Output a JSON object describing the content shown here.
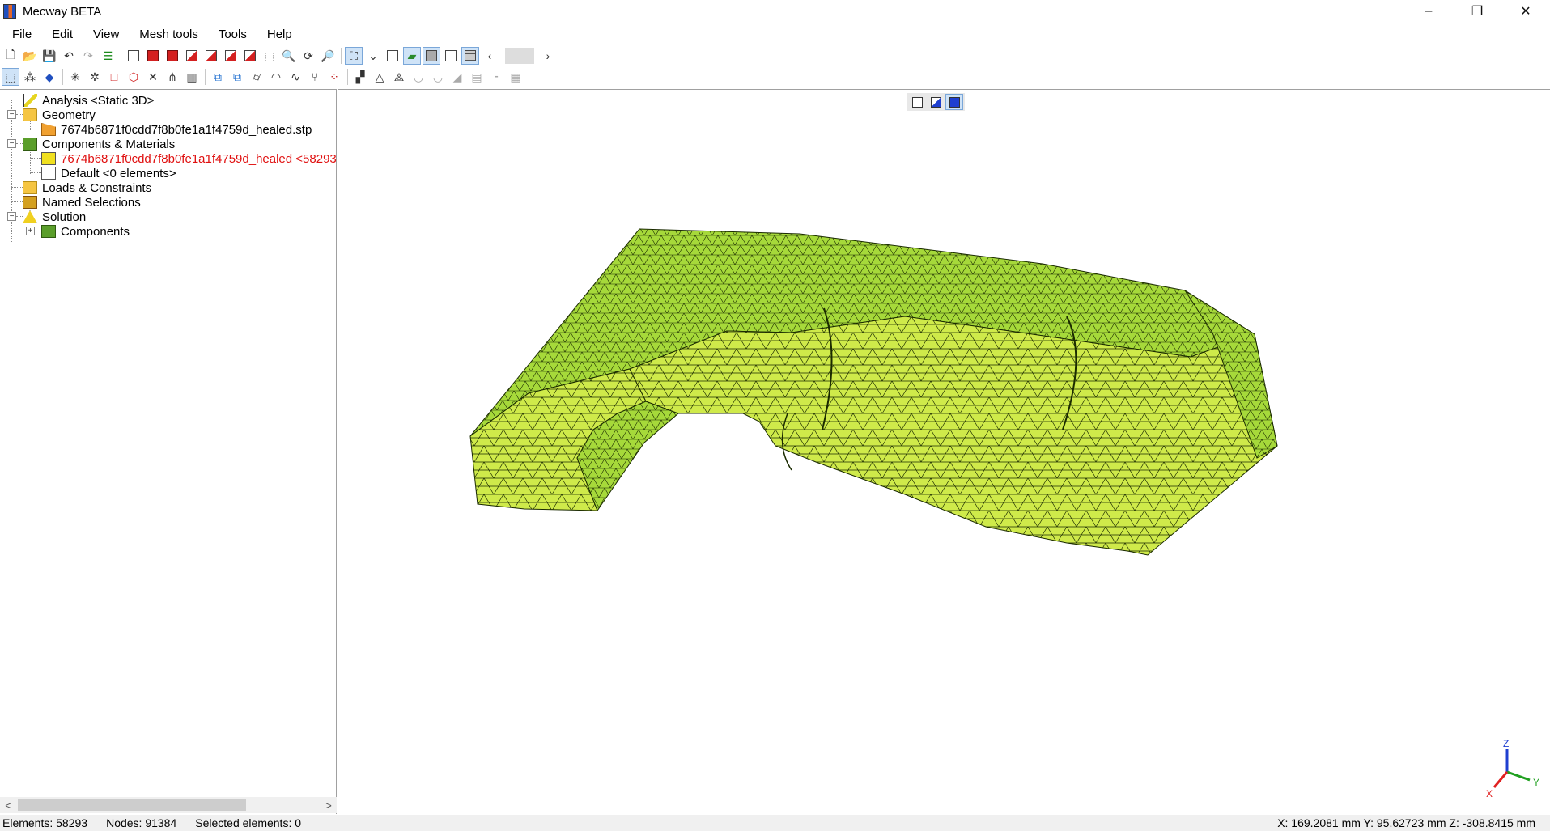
{
  "window": {
    "title": "Mecway BETA",
    "controls": [
      "–",
      "❐",
      "✕"
    ]
  },
  "menu": [
    "File",
    "Edit",
    "View",
    "Mesh tools",
    "Tools",
    "Help"
  ],
  "toolbar": {
    "nav_prev": "‹",
    "nav_next": "›"
  },
  "tree": {
    "analysis": "Analysis <Static 3D>",
    "geometry": "Geometry",
    "geometry_file": "7674b6871f0cdd7f8b0fe1a1f4759d_healed.stp",
    "components_materials": "Components & Materials",
    "component_healed": "7674b6871f0cdd7f8b0fe1a1f4759d_healed <58293",
    "component_default": "Default <0 elements>",
    "loads_constraints": "Loads & Constraints",
    "named_selections": "Named Selections",
    "solution": "Solution",
    "solution_components": "Components"
  },
  "scrollbar": {
    "left": "<",
    "right": ">"
  },
  "axes": {
    "x": "X",
    "y": "Y",
    "z": "Z",
    "x_color": "#e02020",
    "y_color": "#20a020",
    "z_color": "#1f3fd0"
  },
  "mesh": {
    "face_color": "#a6d93a",
    "side_color": "#cfea4a",
    "edge_color": "#1a2a00"
  },
  "status": {
    "elements": "Elements: 58293",
    "nodes": "Nodes: 91384",
    "selected": "Selected elements: 0",
    "coords": "X: 169.2081 mm Y: 95.62723 mm Z: -308.8415 mm"
  }
}
